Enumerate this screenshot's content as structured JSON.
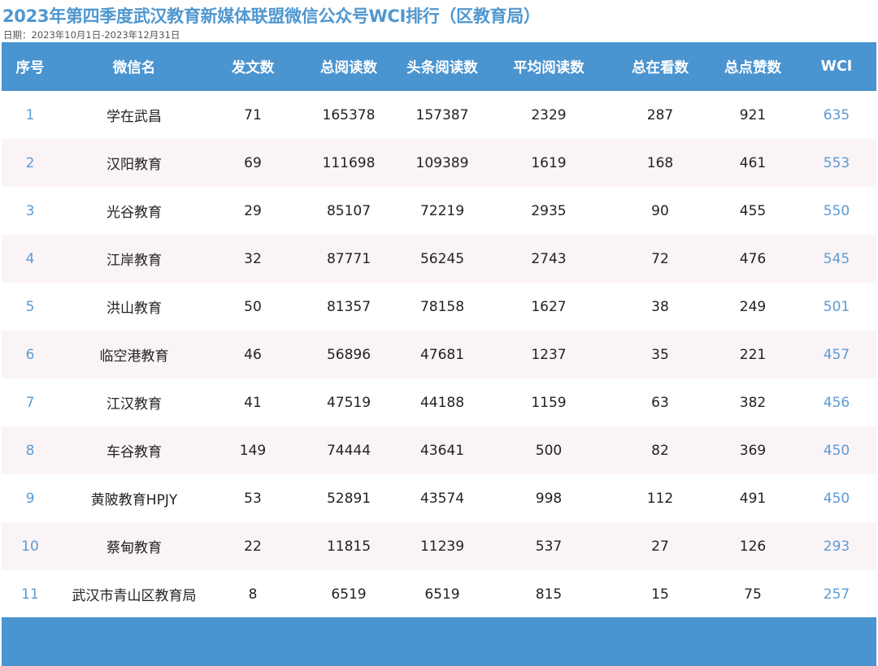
{
  "title": "2023年第四季度武汉教育新媒体联盟微信公众号WCI排行（区教育局）",
  "date": "日期：2023年10月1日-2023年12月31日",
  "colors": {
    "accent": "#4a94d0",
    "title": "#4f97cf",
    "link_blue": "#5b9bd5",
    "stripe": "#fbf4f6"
  },
  "headers": [
    "序号",
    "微信名",
    "发文数",
    "总阅读数",
    "头条阅读数",
    "平均阅读数",
    "总在看数",
    "总点赞数",
    "WCI"
  ],
  "rows": [
    [
      "1",
      "学在武昌",
      "71",
      "165378",
      "157387",
      "2329",
      "287",
      "921",
      "635"
    ],
    [
      "2",
      "汉阳教育",
      "69",
      "111698",
      "109389",
      "1619",
      "168",
      "461",
      "553"
    ],
    [
      "3",
      "光谷教育",
      "29",
      "85107",
      "72219",
      "2935",
      "90",
      "455",
      "550"
    ],
    [
      "4",
      "江岸教育",
      "32",
      "87771",
      "56245",
      "2743",
      "72",
      "476",
      "545"
    ],
    [
      "5",
      "洪山教育",
      "50",
      "81357",
      "78158",
      "1627",
      "38",
      "249",
      "501"
    ],
    [
      "6",
      "临空港教育",
      "46",
      "56896",
      "47681",
      "1237",
      "35",
      "221",
      "457"
    ],
    [
      "7",
      "江汉教育",
      "41",
      "47519",
      "44188",
      "1159",
      "63",
      "382",
      "456"
    ],
    [
      "8",
      "车谷教育",
      "149",
      "74444",
      "43641",
      "500",
      "82",
      "369",
      "450"
    ],
    [
      "9",
      "黄陂教育HPJY",
      "53",
      "52891",
      "43574",
      "998",
      "112",
      "491",
      "450"
    ],
    [
      "10",
      "蔡甸教育",
      "22",
      "11815",
      "11239",
      "537",
      "27",
      "126",
      "293"
    ],
    [
      "11",
      "武汉市青山区教育局",
      "8",
      "6519",
      "6519",
      "815",
      "15",
      "75",
      "257"
    ]
  ]
}
